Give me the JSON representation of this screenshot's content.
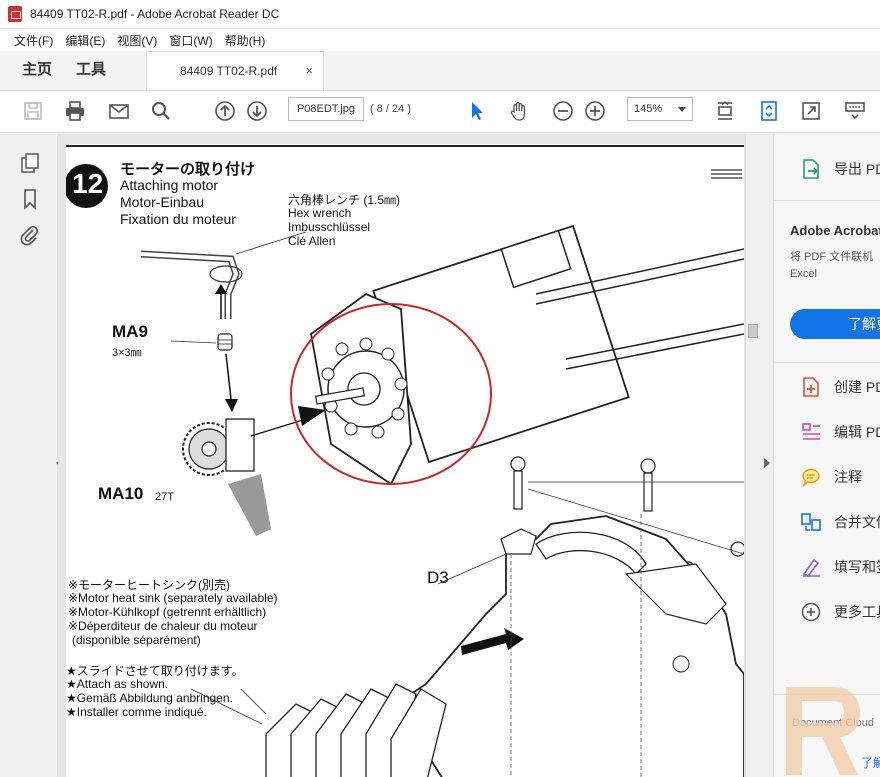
{
  "window": {
    "title": "84409 TT02-R.pdf - Adobe Acrobat Reader DC"
  },
  "menu": [
    "文件(F)",
    "编辑(E)",
    "视图(V)",
    "窗口(W)",
    "帮助(H)"
  ],
  "nav_tabs": {
    "home": "主页",
    "tools": "工具"
  },
  "doc_tab": {
    "label": "84409 TT02-R.pdf",
    "close": "×"
  },
  "toolbar": {
    "page_input": "P08EDT.jpg",
    "page_count": "( 8 / 24 )",
    "zoom": "145%"
  },
  "right_panel": {
    "export_pdf": "导出 PDF",
    "promo_title": "Adobe Acrobat",
    "promo_line1": "将 PDF 文件联机",
    "promo_line2": "Excel",
    "learn_more": "了解更多",
    "tools": [
      "创建 PDF",
      "编辑 PDF",
      "注释",
      "合并文件",
      "填写和签名",
      "更多工具"
    ],
    "doc_cloud": "Document Cloud",
    "learn_link": "了解"
  },
  "page": {
    "step_number": "12",
    "step_title_ja": "モーターの取り付け",
    "step_title_en": "Attaching motor",
    "step_title_de": "Motor-Einbau",
    "step_title_fr": "Fixation du moteur",
    "wrench_ja": "六角棒レンチ (1.5㎜)",
    "wrench_en": "Hex wrench",
    "wrench_de": "Imbusschlüssel",
    "wrench_fr": "Clé Allen",
    "ma9": "MA9",
    "ma9_size": "3×3㎜",
    "ma10": "MA10",
    "ma10_teeth": "27T",
    "d3": "D3",
    "heatsink_ja": "※モーターヒートシンク(別売)",
    "heatsink_en": "※Motor heat sink (separately available)",
    "heatsink_de": "※Motor-Kühlkopf (getrennt erhältlich)",
    "heatsink_fr": "※Déperditeur de chaleur du moteur",
    "heatsink_fr2": "(disponible séparément)",
    "slide_ja": "★スライドさせて取り付けます。",
    "slide_en": "★Attach as shown.",
    "slide_de": "★Gemäß Abbildung anbringen.",
    "slide_fr": "★Installer comme indiqué."
  },
  "colors": {
    "accent": "#1473e6",
    "annotation_circle": "#c62828",
    "adobe_red": "#d32f2f"
  }
}
